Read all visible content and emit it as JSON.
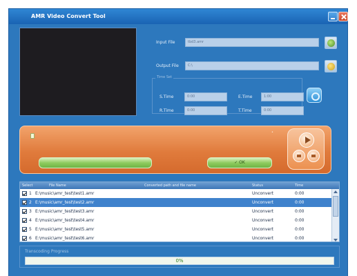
{
  "window": {
    "title": "AMR Video Convert Tool"
  },
  "form": {
    "input_label": "Input File",
    "input_value": "tbd3.amr",
    "output_label": "Output File",
    "output_value": "C:\\",
    "group_title": "Time Set",
    "s_time_a_label": "S.Time",
    "s_time_a_value": "0:00",
    "e_time_label": "E.Time",
    "e_time_value": "1:00",
    "r_time_label": "R.Time",
    "r_time_value": "0:00",
    "t_time_label": "T.Time",
    "t_time_value": "0:00"
  },
  "control": {
    "format_bar": "",
    "ok_label": "OK"
  },
  "list": {
    "columns": [
      "Select",
      "File Name",
      "Converted path and file name",
      "Status",
      "Time"
    ],
    "rows": [
      {
        "num": "1",
        "file": "E:\\music\\amr_test\\test1.amr",
        "status": "Unconvert",
        "time": "0:00",
        "selected": false
      },
      {
        "num": "2",
        "file": "E:\\music\\amr_test\\test2.amr",
        "status": "Unconvert",
        "time": "0:00",
        "selected": true
      },
      {
        "num": "3",
        "file": "E:\\music\\amr_test\\test3.amr",
        "status": "Unconvert",
        "time": "0:00",
        "selected": false
      },
      {
        "num": "4",
        "file": "E:\\music\\amr_test\\test4.amr",
        "status": "Unconvert",
        "time": "0:00",
        "selected": false
      },
      {
        "num": "5",
        "file": "E:\\music\\amr_test\\test5.amr",
        "status": "Unconvert",
        "time": "0:00",
        "selected": false
      },
      {
        "num": "6",
        "file": "E:\\music\\amr_test\\test6.amr",
        "status": "Unconvert",
        "time": "0:00",
        "selected": false
      }
    ]
  },
  "progress": {
    "title": "Transcoding Progress",
    "value": "0%",
    "fraction": 0
  },
  "colors": {
    "window_blue": "#2d78bd",
    "orange_panel": "#e07b3c",
    "selection": "#3f82cc",
    "green_bar": "#8fcb5f"
  }
}
